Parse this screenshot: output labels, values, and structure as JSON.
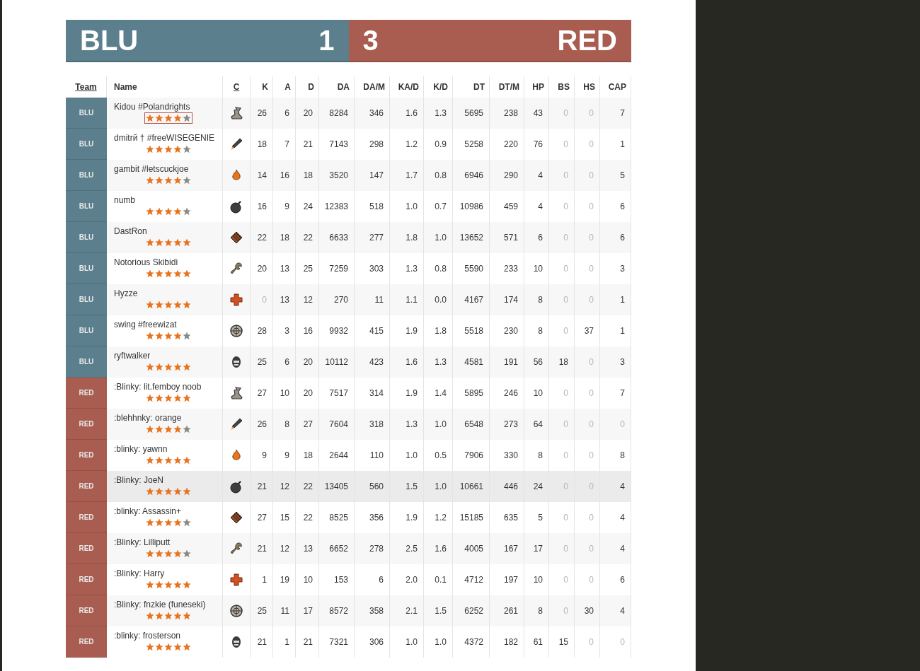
{
  "score": {
    "blu": {
      "label": "BLU",
      "score": "1"
    },
    "red": {
      "label": "RED",
      "score": "3"
    }
  },
  "columns": [
    {
      "label": "Team",
      "link": true
    },
    {
      "label": "Name",
      "link": false
    },
    {
      "label": "C",
      "link": true
    },
    {
      "label": "K",
      "link": false
    },
    {
      "label": "A",
      "link": false
    },
    {
      "label": "D",
      "link": false
    },
    {
      "label": "DA",
      "link": false
    },
    {
      "label": "DA/M",
      "link": false
    },
    {
      "label": "KA/D",
      "link": false
    },
    {
      "label": "K/D",
      "link": false
    },
    {
      "label": "DT",
      "link": false
    },
    {
      "label": "DT/M",
      "link": false
    },
    {
      "label": "HP",
      "link": false
    },
    {
      "label": "BS",
      "link": false
    },
    {
      "label": "HS",
      "link": false
    },
    {
      "label": "CAP",
      "link": false
    }
  ],
  "rows": [
    {
      "team": {
        "label": "BLU",
        "color": "#5b7f8c"
      },
      "name": "Kidou #Polandrights",
      "stars": 4,
      "stars_outlined": true,
      "highlighted": false,
      "kind": "scout",
      "stats": [
        "26",
        "6",
        "20",
        "8284",
        "346",
        "1.6",
        "1.3",
        "5695",
        "238",
        "43",
        "0",
        "0",
        "7"
      ],
      "dimmed": [
        false,
        false,
        false,
        false,
        false,
        false,
        false,
        false,
        false,
        false,
        true,
        true,
        false
      ]
    },
    {
      "team": {
        "label": "BLU",
        "color": "#5b7f8c"
      },
      "name": "dmitrй † #freeWISEGENIE",
      "stars": 4,
      "stars_outlined": false,
      "highlighted": false,
      "kind": "soldier",
      "stats": [
        "18",
        "7",
        "21",
        "7143",
        "298",
        "1.2",
        "0.9",
        "5258",
        "220",
        "76",
        "0",
        "0",
        "1"
      ],
      "dimmed": [
        false,
        false,
        false,
        false,
        false,
        false,
        false,
        false,
        false,
        false,
        true,
        true,
        false
      ]
    },
    {
      "team": {
        "label": "BLU",
        "color": "#5b7f8c"
      },
      "name": "gambit #letscuckjoe",
      "stars": 4,
      "stars_outlined": false,
      "highlighted": false,
      "kind": "pyro",
      "stats": [
        "14",
        "16",
        "18",
        "3520",
        "147",
        "1.7",
        "0.8",
        "6946",
        "290",
        "4",
        "0",
        "0",
        "5"
      ],
      "dimmed": [
        false,
        false,
        false,
        false,
        false,
        false,
        false,
        false,
        false,
        false,
        true,
        true,
        false
      ]
    },
    {
      "team": {
        "label": "BLU",
        "color": "#5b7f8c"
      },
      "name": "numb",
      "stars": 4,
      "stars_outlined": false,
      "highlighted": false,
      "kind": "demoman",
      "stats": [
        "16",
        "9",
        "24",
        "12383",
        "518",
        "1.0",
        "0.7",
        "10986",
        "459",
        "4",
        "0",
        "0",
        "6"
      ],
      "dimmed": [
        false,
        false,
        false,
        false,
        false,
        false,
        false,
        false,
        false,
        false,
        true,
        true,
        false
      ]
    },
    {
      "team": {
        "label": "BLU",
        "color": "#5b7f8c"
      },
      "name": "DastRon",
      "stars": 5,
      "stars_outlined": false,
      "highlighted": false,
      "kind": "heavy",
      "stats": [
        "22",
        "18",
        "22",
        "6633",
        "277",
        "1.8",
        "1.0",
        "13652",
        "571",
        "6",
        "0",
        "0",
        "6"
      ],
      "dimmed": [
        false,
        false,
        false,
        false,
        false,
        false,
        false,
        false,
        false,
        false,
        true,
        true,
        false
      ]
    },
    {
      "team": {
        "label": "BLU",
        "color": "#5b7f8c"
      },
      "name": "Notorious Skibidi",
      "stars": 5,
      "stars_outlined": false,
      "highlighted": false,
      "kind": "engineer",
      "stats": [
        "20",
        "13",
        "25",
        "7259",
        "303",
        "1.3",
        "0.8",
        "5590",
        "233",
        "10",
        "0",
        "0",
        "3"
      ],
      "dimmed": [
        false,
        false,
        false,
        false,
        false,
        false,
        false,
        false,
        false,
        false,
        true,
        true,
        false
      ]
    },
    {
      "team": {
        "label": "BLU",
        "color": "#5b7f8c"
      },
      "name": "Hyzze",
      "stars": 5,
      "stars_outlined": false,
      "highlighted": false,
      "kind": "medic",
      "stats": [
        "0",
        "13",
        "12",
        "270",
        "11",
        "1.1",
        "0.0",
        "4167",
        "174",
        "8",
        "0",
        "0",
        "1"
      ],
      "dimmed": [
        true,
        false,
        false,
        false,
        false,
        false,
        false,
        false,
        false,
        false,
        true,
        true,
        false
      ]
    },
    {
      "team": {
        "label": "BLU",
        "color": "#5b7f8c"
      },
      "name": "swing #freewizat",
      "stars": 4,
      "stars_outlined": false,
      "highlighted": false,
      "kind": "sniper",
      "stats": [
        "28",
        "3",
        "16",
        "9932",
        "415",
        "1.9",
        "1.8",
        "5518",
        "230",
        "8",
        "0",
        "37",
        "1"
      ],
      "dimmed": [
        false,
        false,
        false,
        false,
        false,
        false,
        false,
        false,
        false,
        false,
        true,
        false,
        false
      ]
    },
    {
      "team": {
        "label": "BLU",
        "color": "#5b7f8c"
      },
      "name": "ryftwalker",
      "stars": 5,
      "stars_outlined": false,
      "highlighted": false,
      "kind": "spy",
      "stats": [
        "25",
        "6",
        "20",
        "10112",
        "423",
        "1.6",
        "1.3",
        "4581",
        "191",
        "56",
        "18",
        "0",
        "3"
      ],
      "dimmed": [
        false,
        false,
        false,
        false,
        false,
        false,
        false,
        false,
        false,
        false,
        false,
        true,
        false
      ]
    },
    {
      "team": {
        "label": "RED",
        "color": "#a85d50"
      },
      "name": ":Blinky: lit.femboy noob",
      "stars": 5,
      "stars_outlined": false,
      "highlighted": false,
      "kind": "scout",
      "stats": [
        "27",
        "10",
        "20",
        "7517",
        "314",
        "1.9",
        "1.4",
        "5895",
        "246",
        "10",
        "0",
        "0",
        "7"
      ],
      "dimmed": [
        false,
        false,
        false,
        false,
        false,
        false,
        false,
        false,
        false,
        false,
        true,
        true,
        false
      ]
    },
    {
      "team": {
        "label": "RED",
        "color": "#a85d50"
      },
      "name": ":blehhnky: orange",
      "stars": 4,
      "stars_outlined": false,
      "highlighted": false,
      "kind": "soldier",
      "stats": [
        "26",
        "8",
        "27",
        "7604",
        "318",
        "1.3",
        "1.0",
        "6548",
        "273",
        "64",
        "0",
        "0",
        "0"
      ],
      "dimmed": [
        false,
        false,
        false,
        false,
        false,
        false,
        false,
        false,
        false,
        false,
        true,
        true,
        true
      ]
    },
    {
      "team": {
        "label": "RED",
        "color": "#a85d50"
      },
      "name": ":blinky: yawnn",
      "stars": 5,
      "stars_outlined": false,
      "highlighted": false,
      "kind": "pyro",
      "stats": [
        "9",
        "9",
        "18",
        "2644",
        "110",
        "1.0",
        "0.5",
        "7906",
        "330",
        "8",
        "0",
        "0",
        "8"
      ],
      "dimmed": [
        false,
        false,
        false,
        false,
        false,
        false,
        false,
        false,
        false,
        false,
        true,
        true,
        false
      ]
    },
    {
      "team": {
        "label": "RED",
        "color": "#a85d50"
      },
      "name": ":Blinky: JoeN",
      "stars": 5,
      "stars_outlined": false,
      "highlighted": true,
      "kind": "demoman",
      "stats": [
        "21",
        "12",
        "22",
        "13405",
        "560",
        "1.5",
        "1.0",
        "10661",
        "446",
        "24",
        "0",
        "0",
        "4"
      ],
      "dimmed": [
        false,
        false,
        false,
        false,
        false,
        false,
        false,
        false,
        false,
        false,
        true,
        true,
        false
      ]
    },
    {
      "team": {
        "label": "RED",
        "color": "#a85d50"
      },
      "name": ":blinky: Assassin+",
      "stars": 4,
      "stars_outlined": false,
      "highlighted": false,
      "kind": "heavy",
      "stats": [
        "27",
        "15",
        "22",
        "8525",
        "356",
        "1.9",
        "1.2",
        "15185",
        "635",
        "5",
        "0",
        "0",
        "4"
      ],
      "dimmed": [
        false,
        false,
        false,
        false,
        false,
        false,
        false,
        false,
        false,
        false,
        true,
        true,
        false
      ]
    },
    {
      "team": {
        "label": "RED",
        "color": "#a85d50"
      },
      "name": ":Blinky: Lilliputt",
      "stars": 4,
      "stars_outlined": false,
      "highlighted": false,
      "kind": "engineer",
      "stats": [
        "21",
        "12",
        "13",
        "6652",
        "278",
        "2.5",
        "1.6",
        "4005",
        "167",
        "17",
        "0",
        "0",
        "4"
      ],
      "dimmed": [
        false,
        false,
        false,
        false,
        false,
        false,
        false,
        false,
        false,
        false,
        true,
        true,
        false
      ]
    },
    {
      "team": {
        "label": "RED",
        "color": "#a85d50"
      },
      "name": ":Blinky: Harry",
      "stars": 5,
      "stars_outlined": false,
      "highlighted": false,
      "kind": "medic",
      "stats": [
        "1",
        "19",
        "10",
        "153",
        "6",
        "2.0",
        "0.1",
        "4712",
        "197",
        "10",
        "0",
        "0",
        "6"
      ],
      "dimmed": [
        false,
        false,
        false,
        false,
        false,
        false,
        false,
        false,
        false,
        false,
        true,
        true,
        false
      ]
    },
    {
      "team": {
        "label": "RED",
        "color": "#a85d50"
      },
      "name": ":Blinky: fnzkie (funeseki)",
      "stars": 5,
      "stars_outlined": false,
      "highlighted": false,
      "kind": "sniper",
      "stats": [
        "25",
        "11",
        "17",
        "8572",
        "358",
        "2.1",
        "1.5",
        "6252",
        "261",
        "8",
        "0",
        "30",
        "4"
      ],
      "dimmed": [
        false,
        false,
        false,
        false,
        false,
        false,
        false,
        false,
        false,
        false,
        true,
        false,
        false
      ]
    },
    {
      "team": {
        "label": "RED",
        "color": "#a85d50"
      },
      "name": ":blinky: frosterson",
      "stars": 5,
      "stars_outlined": false,
      "highlighted": false,
      "kind": "spy",
      "stats": [
        "21",
        "1",
        "21",
        "7321",
        "306",
        "1.0",
        "1.0",
        "4372",
        "182",
        "61",
        "15",
        "0",
        "0"
      ],
      "dimmed": [
        false,
        false,
        false,
        false,
        false,
        false,
        false,
        false,
        false,
        false,
        false,
        true,
        true
      ]
    }
  ]
}
